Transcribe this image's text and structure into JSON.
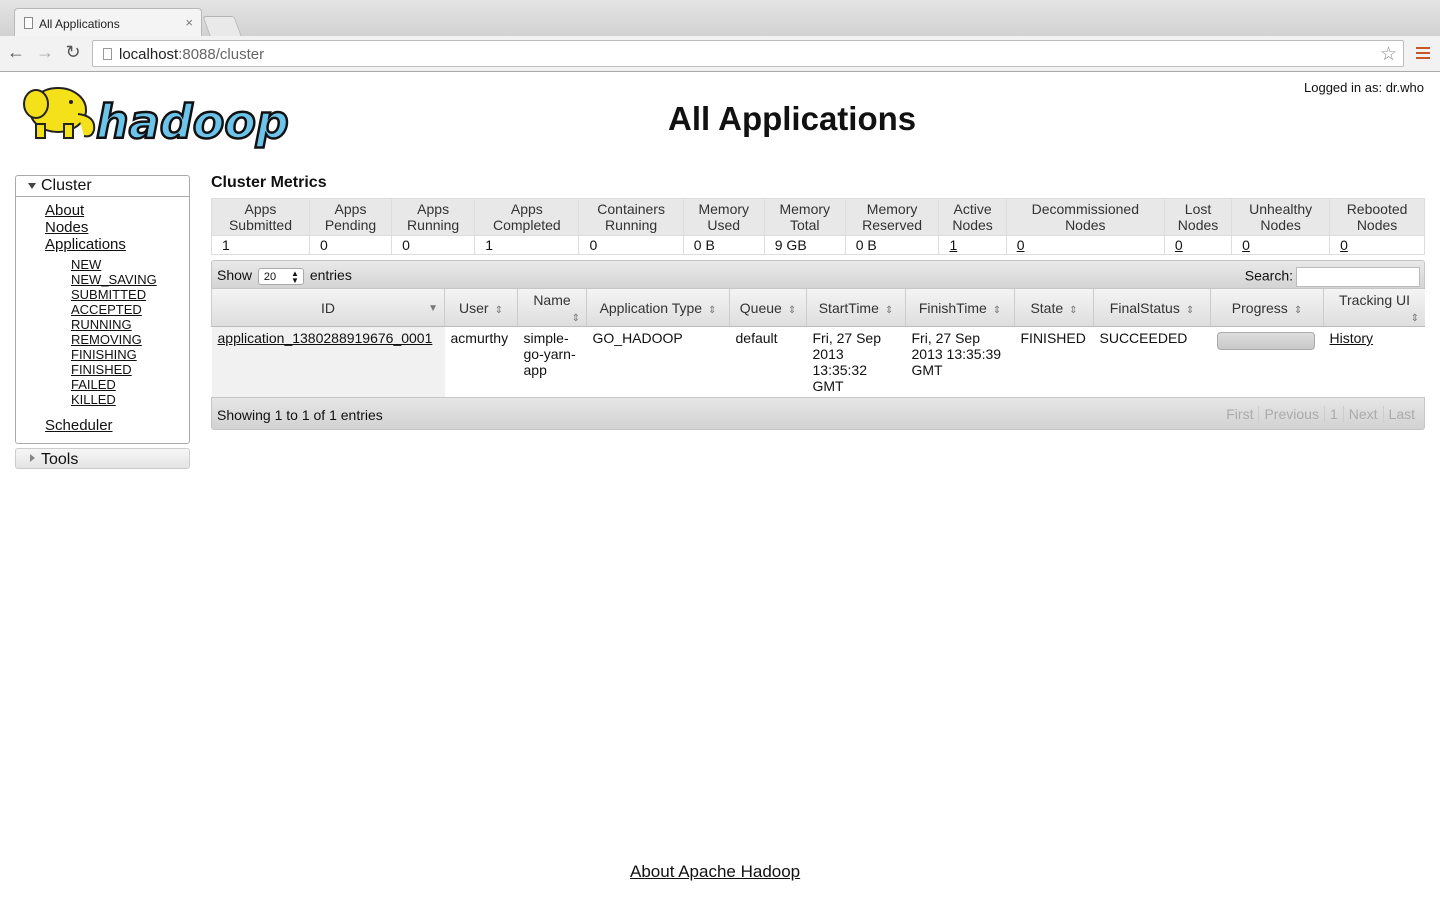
{
  "browser": {
    "tab_title": "All Applications",
    "tab_close": "×",
    "url_host": "localhost",
    "url_rest": ":8088/cluster",
    "back": "←",
    "forward": "→",
    "reload": "↻",
    "star": "☆"
  },
  "header": {
    "logo_text": "hadoop",
    "title": "All Applications",
    "logged_in": "Logged in as: dr.who"
  },
  "sidebar": {
    "cluster_label": "Cluster",
    "items": [
      "About",
      "Nodes",
      "Applications"
    ],
    "app_states": [
      "NEW",
      "NEW_SAVING",
      "SUBMITTED",
      "ACCEPTED",
      "RUNNING",
      "REMOVING",
      "FINISHING",
      "FINISHED",
      "FAILED",
      "KILLED"
    ],
    "scheduler": "Scheduler",
    "tools_label": "Tools"
  },
  "metrics": {
    "title": "Cluster Metrics",
    "headers": [
      [
        "Apps",
        "Submitted"
      ],
      [
        "Apps",
        "Pending"
      ],
      [
        "Apps",
        "Running"
      ],
      [
        "Apps",
        "Completed"
      ],
      [
        "Containers",
        "Running"
      ],
      [
        "Memory",
        "Used"
      ],
      [
        "Memory",
        "Total"
      ],
      [
        "Memory",
        "Reserved"
      ],
      [
        "Active",
        "Nodes"
      ],
      [
        "Decommissioned",
        "Nodes"
      ],
      [
        "Lost",
        "Nodes"
      ],
      [
        "Unhealthy",
        "Nodes"
      ],
      [
        "Rebooted",
        "Nodes"
      ]
    ],
    "values": [
      "1",
      "0",
      "0",
      "1",
      "0",
      "0 B",
      "9 GB",
      "0 B",
      "1",
      "0",
      "0",
      "0",
      "0"
    ],
    "linked": [
      false,
      false,
      false,
      false,
      false,
      false,
      false,
      false,
      true,
      true,
      true,
      true,
      true
    ]
  },
  "table": {
    "show_label": "Show",
    "entries_value": "20",
    "entries_label": "entries",
    "search_label": "Search:",
    "columns": [
      "ID",
      "User",
      "Name",
      "Application Type",
      "Queue",
      "StartTime",
      "FinishTime",
      "State",
      "FinalStatus",
      "Progress",
      "Tracking UI"
    ],
    "rows": [
      {
        "id": "application_1380288919676_0001",
        "user": "acmurthy",
        "name": "simple-go-yarn-app",
        "type": "GO_HADOOP",
        "queue": "default",
        "start": "Fri, 27 Sep 2013 13:35:32 GMT",
        "finish": "Fri, 27 Sep 2013 13:35:39 GMT",
        "state": "FINISHED",
        "final_status": "SUCCEEDED",
        "tracking": "History"
      }
    ],
    "info": "Showing 1 to 1 of 1 entries",
    "pager": [
      "First",
      "Previous",
      "1",
      "Next",
      "Last"
    ]
  },
  "footer": {
    "link": "About Apache Hadoop"
  },
  "colors": {
    "logo_yellow": "#f5e11a",
    "logo_blue": "#6cc4ea",
    "menu_icon": "#c8562a"
  }
}
